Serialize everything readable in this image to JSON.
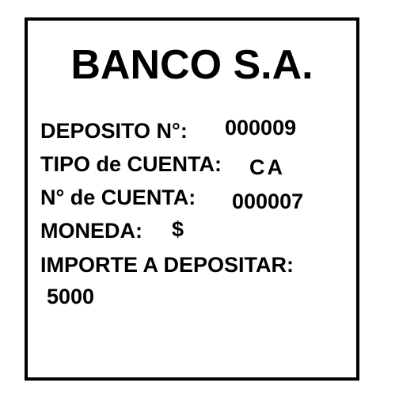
{
  "bank_name": "BANCO S.A.",
  "deposit": {
    "number_label": "DEPOSITO N°:",
    "number_value": "000009",
    "account_type_label": "TIPO de CUENTA:",
    "account_type_value": "CA",
    "account_number_label": "N° de CUENTA:",
    "account_number_value": "000007",
    "currency_label": "MONEDA:",
    "currency_value": "$",
    "amount_label": "IMPORTE A DEPOSITAR:",
    "amount_value": "5000"
  }
}
